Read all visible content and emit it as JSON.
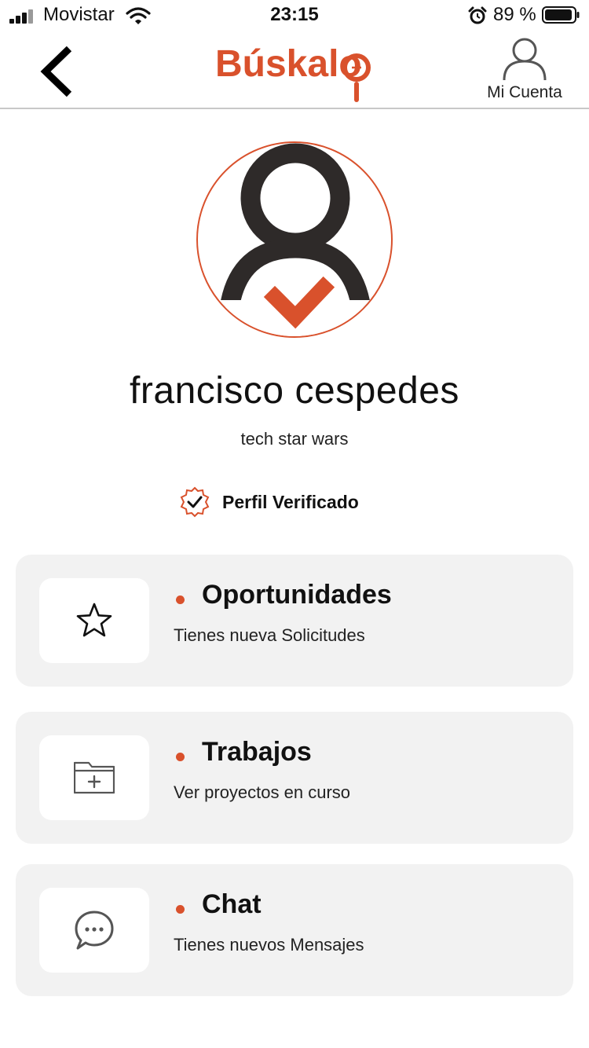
{
  "status_bar": {
    "carrier": "Movistar",
    "time": "23:15",
    "battery_percent": "89 %",
    "icons": [
      "signal-icon",
      "wifi-icon",
      "alarm-icon",
      "battery-icon"
    ]
  },
  "header": {
    "logo_text": "Búskalo",
    "account_label": "Mi Cuenta",
    "icons": [
      "back-chevron-icon",
      "magnifier-icon",
      "user-icon"
    ]
  },
  "profile": {
    "name": "francisco cespedes",
    "company": "tech star wars",
    "verified_label": "Perfil Verificado",
    "icons": [
      "avatar-verified-icon",
      "verified-badge-icon"
    ]
  },
  "cards": [
    {
      "title": "Oportunidades",
      "subtitle": "Tienes nueva Solicitudes",
      "icon": "star-icon"
    },
    {
      "title": "Trabajos",
      "subtitle": "Ver proyectos en curso",
      "icon": "folder-plus-icon"
    },
    {
      "title": "Chat",
      "subtitle": "Tienes nuevos Mensajes",
      "icon": "chat-bubble-icon"
    }
  ],
  "colors": {
    "accent": "#d9512c",
    "card_background": "#f2f2f2",
    "text": "#111111",
    "divider": "#c8c8c8"
  }
}
